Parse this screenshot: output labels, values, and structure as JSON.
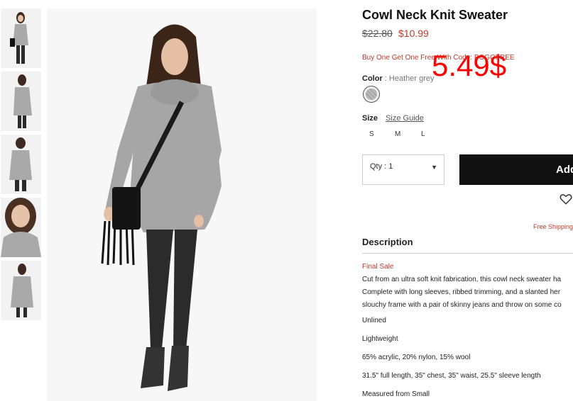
{
  "gallery": {
    "thumbnails": [
      "thumbnail-front",
      "thumbnail-side",
      "thumbnail-back",
      "thumbnail-closeup",
      "thumbnail-alt"
    ]
  },
  "product": {
    "title": "Cowl Neck Knit Sweater",
    "old_price": "$22.80",
    "price": "$10.99",
    "promo": "Buy One Get One Free With Code: BOGOFREE",
    "overlay_price": "5.49$",
    "color_label": "Color",
    "color_sep": " : ",
    "color_value": "Heather grey",
    "size_label": "Size",
    "size_guide": "Size Guide",
    "sizes": [
      "S",
      "M",
      "L"
    ],
    "qty_label": "Qty : 1",
    "add_button": "Add",
    "free_shipping": "Free Shipping",
    "description_heading": "Description",
    "final_sale": "Final Sale",
    "description_lines": [
      "Cut from an ultra soft knit fabrication, this cowl neck sweater ha",
      "Complete with long sleeves, ribbed trimming, and a slanted her",
      "slouchy frame with a pair of skinny jeans and throw on some co",
      "Unlined",
      "Lightweight",
      "65% acrylic, 20% nylon, 15% wool",
      "31.5\" full length, 35\" chest, 35\" waist, 25.5\" sleeve length",
      "Measured from Small"
    ]
  },
  "colors": {
    "accent": "#c0392b",
    "overlay": "#ff0000",
    "button": "#111111"
  }
}
